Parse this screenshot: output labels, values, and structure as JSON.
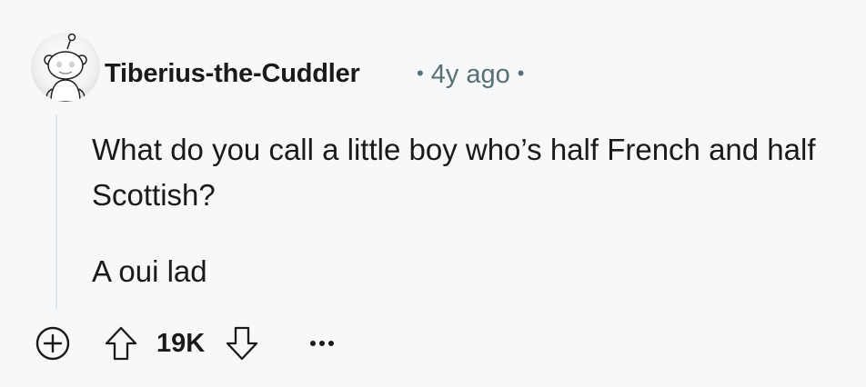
{
  "comment": {
    "author": "Tiberius-the-Cuddler",
    "separator": "•",
    "time_ago": "4y ago",
    "body": [
      "What do you call a little boy who’s half French and half Scottish?",
      "A oui lad"
    ],
    "score": "19K"
  },
  "icons": {
    "avatar": "reddit-snoo-avatar",
    "expand": "plus-circle-icon",
    "upvote": "arrow-up-outline-icon",
    "downvote": "arrow-down-outline-icon",
    "more": "ellipsis-icon"
  },
  "colors": {
    "background": "#f7f8f9",
    "text": "#1a1a1b",
    "meta_text": "#576f76",
    "thread_line": "#e3e6e8"
  }
}
